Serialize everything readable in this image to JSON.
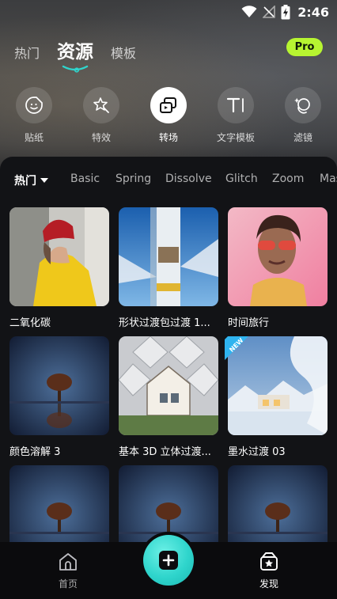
{
  "status": {
    "time": "2:46"
  },
  "top_tabs": [
    {
      "label": "热门",
      "active": false
    },
    {
      "label": "资源",
      "active": true
    },
    {
      "label": "模板",
      "active": false
    }
  ],
  "pro_badge": "Pro",
  "categories": [
    {
      "label": "贴纸",
      "icon": "sticker-icon",
      "active": false
    },
    {
      "label": "特效",
      "icon": "effects-icon",
      "active": false
    },
    {
      "label": "转场",
      "icon": "transition-icon",
      "active": true
    },
    {
      "label": "文字模板",
      "icon": "text-template-icon",
      "active": false
    },
    {
      "label": "滤镜",
      "icon": "filter-icon",
      "active": false
    }
  ],
  "filters": {
    "active": "热门",
    "items": [
      "Basic",
      "Spring",
      "Dissolve",
      "Glitch",
      "Zoom",
      "Mas"
    ]
  },
  "cards": [
    {
      "title": "二氧化碳",
      "new": false
    },
    {
      "title": "形状过渡包过渡 1...",
      "new": false
    },
    {
      "title": "时间旅行",
      "new": false
    },
    {
      "title": "颜色溶解 3",
      "new": false
    },
    {
      "title": "基本 3D 立体过渡...",
      "new": false
    },
    {
      "title": "墨水过渡 03",
      "new": true,
      "badge": "NEW"
    },
    {
      "title": "",
      "new": false
    },
    {
      "title": "",
      "new": false
    },
    {
      "title": "",
      "new": false
    }
  ],
  "bottom_nav": [
    {
      "label": "首页",
      "icon": "home-icon",
      "active": false
    },
    {
      "label": "发现",
      "icon": "discover-icon",
      "active": true
    }
  ],
  "colors": {
    "accent_green": "#b7f531",
    "accent_teal": "#2fd5cc",
    "panel": "#121316"
  }
}
